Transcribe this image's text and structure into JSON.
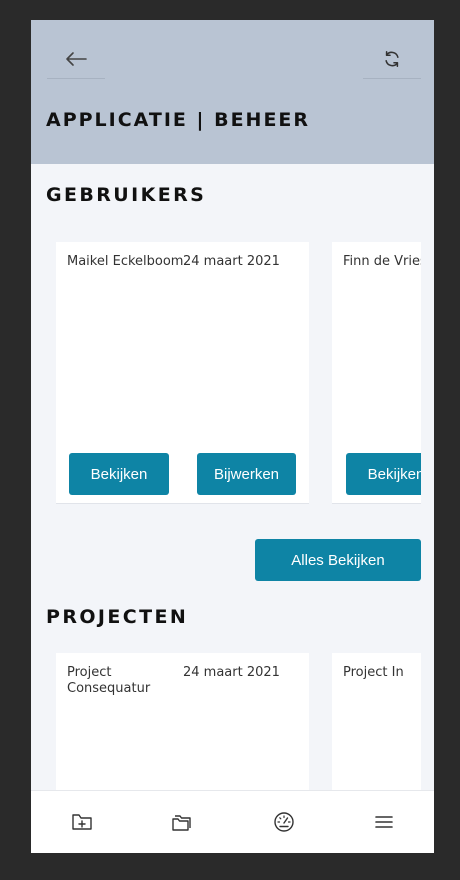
{
  "header": {
    "title": "APPLICATIE | BEHEER",
    "back_icon": "arrow-left-icon",
    "refresh_icon": "refresh-icon"
  },
  "users": {
    "section_title": "GEBRUIKERS",
    "cards": [
      {
        "name": "Maikel Eckelboom",
        "date": "24 maart 2021",
        "view_label": "Bekijken",
        "edit_label": "Bijwerken"
      },
      {
        "name": "Finn de Vries",
        "view_label": "Bekijken"
      }
    ],
    "view_all_label": "Alles Bekijken"
  },
  "projects": {
    "section_title": "PROJECTEN",
    "cards": [
      {
        "name_line1": "Project",
        "name_line2": "Consequatur",
        "date": "24 maart 2021"
      },
      {
        "name_line1": "Project In"
      }
    ]
  },
  "bottom_nav": {
    "items": [
      "folder-add-icon",
      "folders-icon",
      "dashboard-gauge-icon",
      "menu-icon"
    ]
  },
  "colors": {
    "header_bg": "#b9c4d3",
    "accent": "#0e84a5",
    "page_bg": "#f3f5f9"
  }
}
